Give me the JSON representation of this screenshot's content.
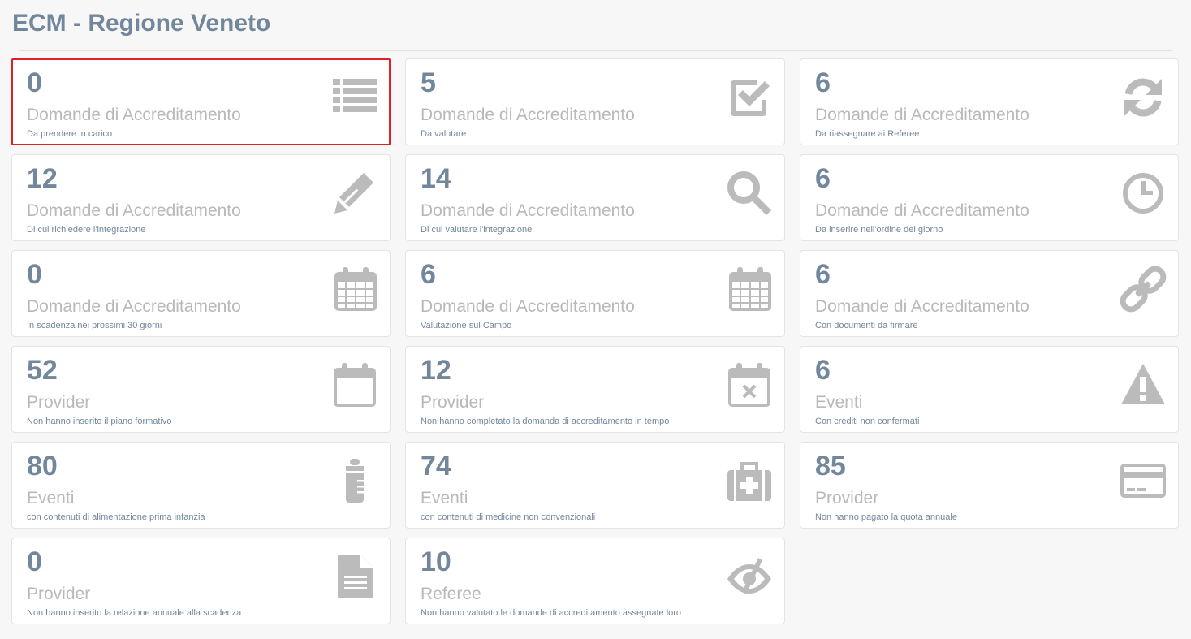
{
  "page": {
    "title": "ECM - Regione Veneto"
  },
  "colors": {
    "accent": "#73879c",
    "icon": "#bbbbbb",
    "label": "#bab8b8",
    "selected_border": "#e01f26"
  },
  "tiles": [
    {
      "count": "0",
      "label": "Domande di Accreditamento",
      "sub": "Da prendere in carico",
      "icon": "list-icon",
      "selected": true
    },
    {
      "count": "5",
      "label": "Domande di Accreditamento",
      "sub": "Da valutare",
      "icon": "check-square-icon"
    },
    {
      "count": "6",
      "label": "Domande di Accreditamento",
      "sub": "Da riassegnare ai Referee",
      "icon": "refresh-icon"
    },
    {
      "count": "12",
      "label": "Domande di Accreditamento",
      "sub": "Di cui richiedere l'integrazione",
      "icon": "pencil-icon"
    },
    {
      "count": "14",
      "label": "Domande di Accreditamento",
      "sub": "Di cui valutare l'integrazione",
      "icon": "search-icon"
    },
    {
      "count": "6",
      "label": "Domande di Accreditamento",
      "sub": "Da inserire nell'ordine del giorno",
      "icon": "clock-icon"
    },
    {
      "count": "0",
      "label": "Domande di Accreditamento",
      "sub": "In scadenza nei prossimi 30 giorni",
      "icon": "calendar-icon"
    },
    {
      "count": "6",
      "label": "Domande di Accreditamento",
      "sub": "Valutazione sul Campo",
      "icon": "calendar-icon"
    },
    {
      "count": "6",
      "label": "Domande di Accreditamento",
      "sub": "Con documenti da firmare",
      "icon": "chain-icon"
    },
    {
      "count": "52",
      "label": "Provider",
      "sub": "Non hanno inserito il piano formativo",
      "icon": "calendar-blank-icon"
    },
    {
      "count": "12",
      "label": "Provider",
      "sub": "Non hanno completato la domanda di accreditamento in tempo",
      "icon": "calendar-x-icon"
    },
    {
      "count": "6",
      "label": "Eventi",
      "sub": "Con crediti non confermati",
      "icon": "warning-icon"
    },
    {
      "count": "80",
      "label": "Eventi",
      "sub": "con contenuti di alimentazione prima infanzia",
      "icon": "baby-bottle-icon"
    },
    {
      "count": "74",
      "label": "Eventi",
      "sub": "con contenuti di medicine non convenzionali",
      "icon": "medkit-icon"
    },
    {
      "count": "85",
      "label": "Provider",
      "sub": "Non hanno pagato la quota annuale",
      "icon": "credit-card-icon"
    },
    {
      "count": "0",
      "label": "Provider",
      "sub": "Non hanno inserito la relazione annuale alla scadenza",
      "icon": "document-icon"
    },
    {
      "count": "10",
      "label": "Referee",
      "sub": "Non hanno valutato le domande di accreditamento assegnate loro",
      "icon": "eye-slash-icon"
    }
  ]
}
